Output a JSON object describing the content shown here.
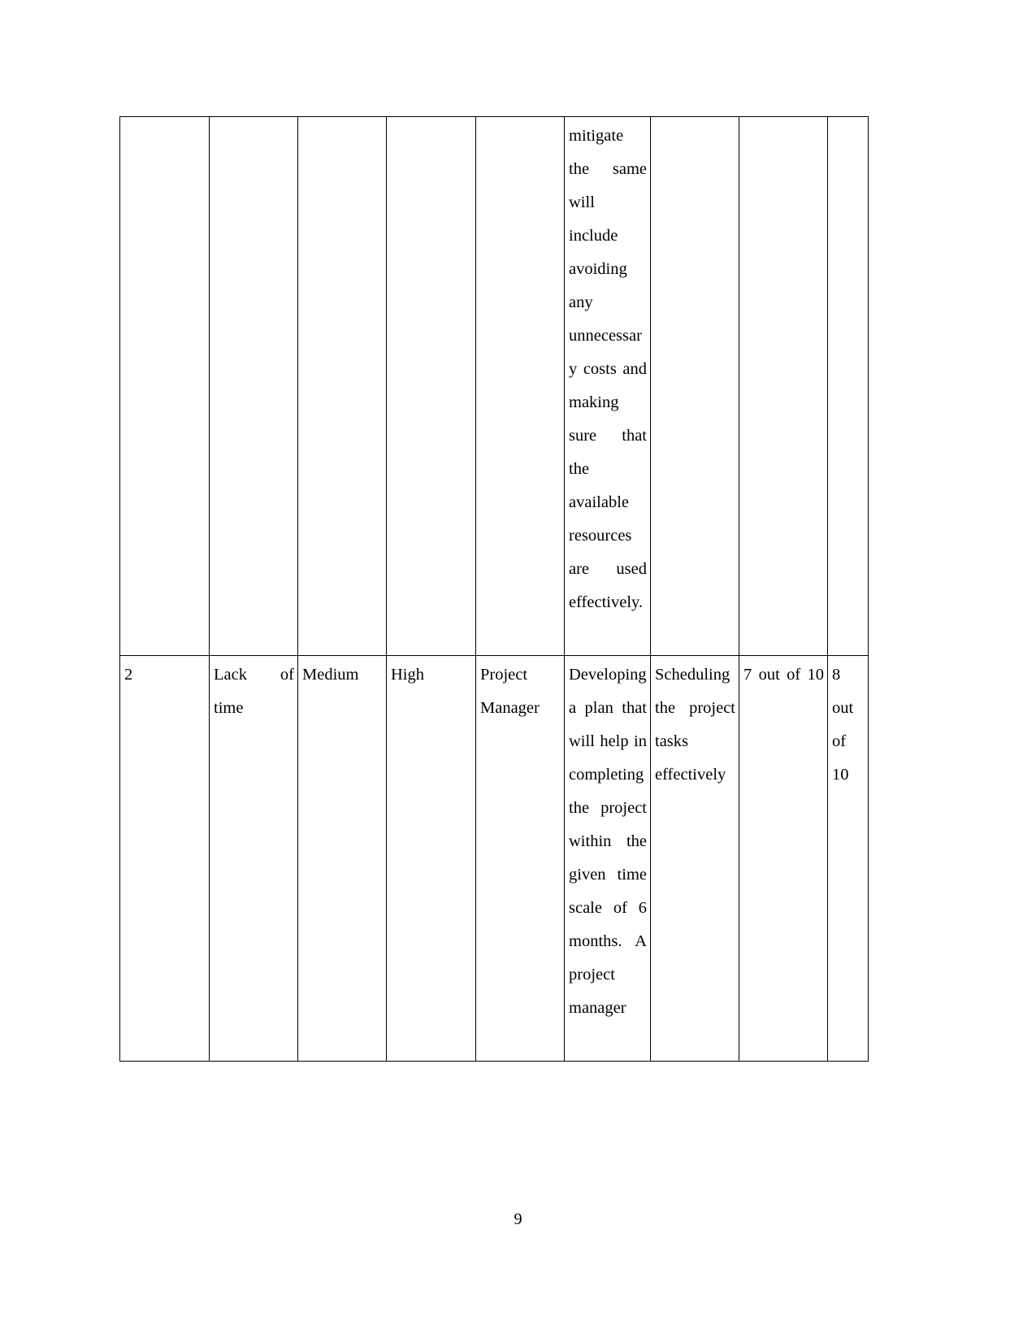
{
  "document": {
    "page_number": "9",
    "table": {
      "name": "risk-register-table",
      "column_count": 9,
      "rows": [
        {
          "row_id": "row-continued",
          "cells": [
            {
              "col": 1,
              "text": "",
              "align": "left"
            },
            {
              "col": 2,
              "text": "",
              "align": "left"
            },
            {
              "col": 3,
              "text": "",
              "align": "left"
            },
            {
              "col": 4,
              "text": "",
              "align": "left"
            },
            {
              "col": 5,
              "text": "",
              "align": "left"
            },
            {
              "col": 6,
              "text": "mitigate the same will include avoiding any unnecessary costs and making sure that the available resources are used effectively.",
              "align": "justify"
            },
            {
              "col": 7,
              "text": "",
              "align": "left"
            },
            {
              "col": 8,
              "text": "",
              "align": "left"
            },
            {
              "col": 9,
              "text": "",
              "align": "left"
            }
          ]
        },
        {
          "row_id": "row-2",
          "cells": [
            {
              "col": 1,
              "text": "2",
              "align": "left"
            },
            {
              "col": 2,
              "text": "Lack of time",
              "align": "justify"
            },
            {
              "col": 3,
              "text": "Medium",
              "align": "left"
            },
            {
              "col": 4,
              "text": "High",
              "align": "left"
            },
            {
              "col": 5,
              "text": "Project Manager",
              "align": "left"
            },
            {
              "col": 6,
              "text": "Developing a plan that will help in completing the project within the given time scale of 6 months. A project manager",
              "align": "justify"
            },
            {
              "col": 7,
              "text": "Scheduling the project tasks effectively",
              "align": "justify"
            },
            {
              "col": 8,
              "text": "7 out of 10",
              "align": "justify"
            },
            {
              "col": 9,
              "text": "8 out of 10",
              "align": "justify"
            }
          ]
        }
      ]
    }
  }
}
